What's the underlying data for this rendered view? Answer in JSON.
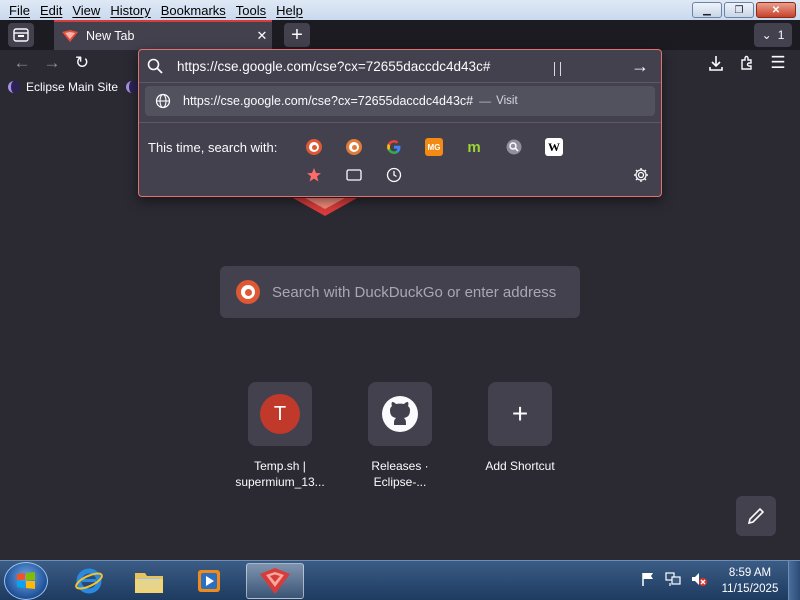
{
  "menu": [
    "File",
    "Edit",
    "View",
    "History",
    "Bookmarks",
    "Tools",
    "Help"
  ],
  "tab": {
    "title": "New Tab",
    "close": "✕"
  },
  "tab_count": "1",
  "bookmarks": [
    {
      "label": "Eclipse Main Site"
    }
  ],
  "urlbar": {
    "value": "https://cse.google.com/cse?cx=72655daccdc4d43c#",
    "result_url": "https://cse.google.com/cse?cx=72655daccdc4d43c#",
    "result_dash": "—",
    "result_action": "Visit",
    "search_with_label": "This time, search with:",
    "engines": [
      "DuckDuckGo",
      "DuckDuckGo",
      "Google",
      "MG",
      "m",
      "Search",
      "Wikipedia"
    ],
    "engine_glyphs": {
      "mg": "MG",
      "m": "m",
      "w": "W"
    }
  },
  "search": {
    "placeholder": "Search with DuckDuckGo or enter address"
  },
  "shortcuts": [
    {
      "label": "Temp.sh | supermium_13...",
      "avatar": "T"
    },
    {
      "label": "Releases · Eclipse-..."
    },
    {
      "label": "Add Shortcut"
    }
  ],
  "taskbar": {
    "time": "8:59 AM",
    "date": "11/15/2025"
  },
  "colors": {
    "accent": "#d93b3b",
    "bg": "#2b2a33",
    "panel": "#42414d"
  }
}
